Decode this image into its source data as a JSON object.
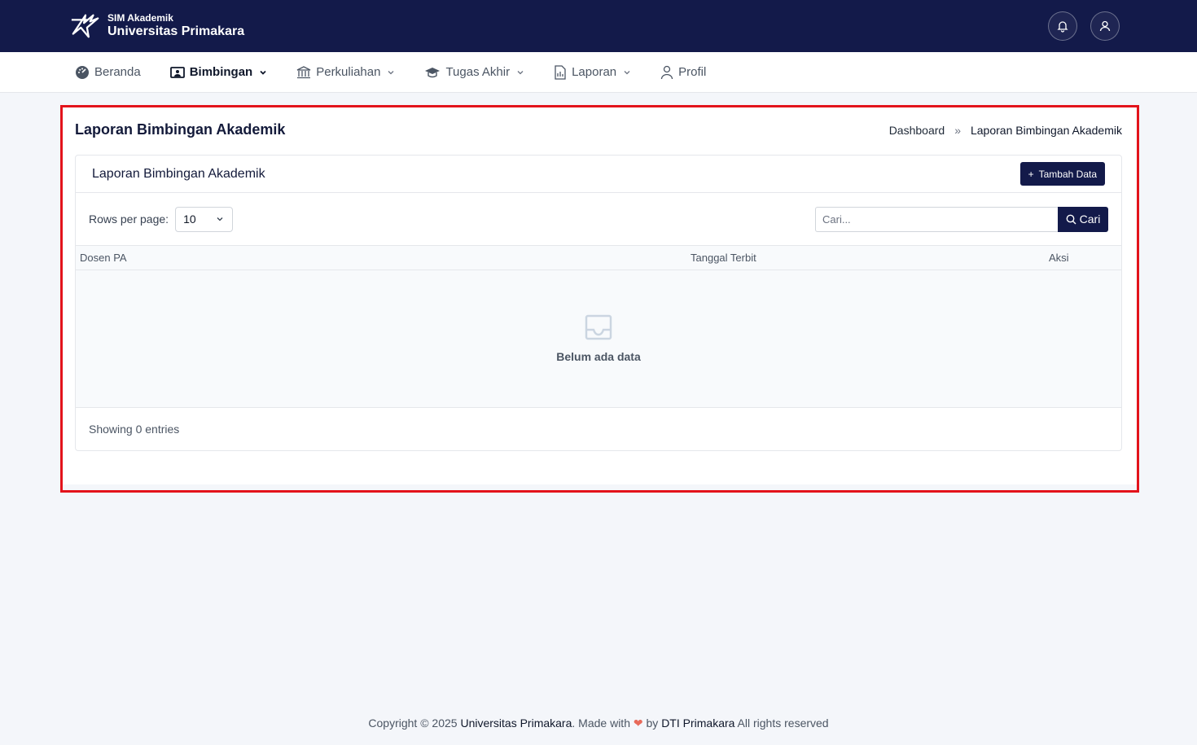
{
  "brand": {
    "subtitle": "SIM Akademik",
    "title": "Universitas Primakara"
  },
  "nav": {
    "items": [
      {
        "label": "Beranda"
      },
      {
        "label": "Bimbingan"
      },
      {
        "label": "Perkuliahan"
      },
      {
        "label": "Tugas Akhir"
      },
      {
        "label": "Laporan"
      },
      {
        "label": "Profil"
      }
    ]
  },
  "page": {
    "title": "Laporan Bimbingan Akademik",
    "breadcrumb": {
      "home": "Dashboard",
      "separator": "»",
      "current": "Laporan Bimbingan Akademik"
    }
  },
  "card": {
    "title": "Laporan Bimbingan Akademik",
    "add_button": "Tambah Data",
    "rows_per_page_label": "Rows per page:",
    "rows_per_page_value": "10",
    "search_placeholder": "Cari...",
    "search_button": "Cari",
    "columns": [
      "Dosen PA",
      "Tanggal Terbit",
      "Aksi"
    ],
    "empty_text": "Belum ada data",
    "entries_text": "Showing 0 entries"
  },
  "footer": {
    "prefix": "Copyright © 2025",
    "org": "Universitas Primakara",
    "made_with": ". Made with",
    "by": "by",
    "team": "DTI Primakara",
    "suffix": "All rights reserved"
  },
  "colors": {
    "primary": "#131a4a",
    "highlight": "#e3131b",
    "heart": "#e86a5a"
  }
}
